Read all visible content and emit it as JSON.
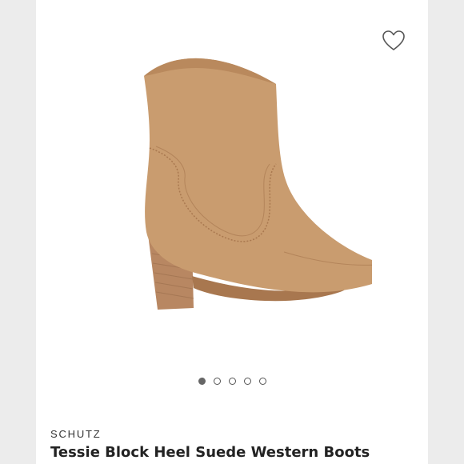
{
  "product": {
    "brand": "SCHUTZ",
    "title": "Tessie Block Heel Suede Western Boots",
    "image_icon": "suede-western-boot"
  },
  "favorite": {
    "icon": "heart-outline-icon",
    "selected": false
  },
  "carousel": {
    "total": 5,
    "active_index": 0
  },
  "colors": {
    "background": "#ffffff",
    "suede": "#c79a6e",
    "heel": "#b58560",
    "dot_active": "#666666"
  }
}
